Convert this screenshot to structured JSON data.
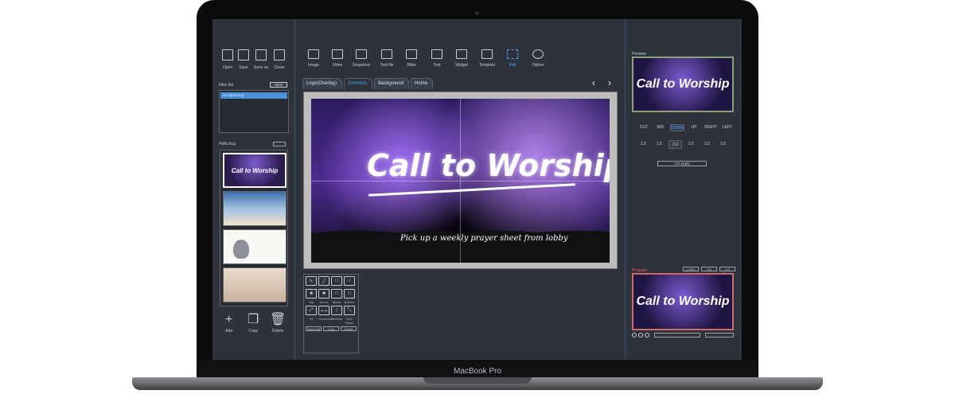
{
  "device": {
    "brand": "MacBook Pro"
  },
  "left_toolbar": [
    {
      "label": "Open",
      "icon": "file-icon"
    },
    {
      "label": "Save",
      "icon": "save-icon"
    },
    {
      "label": "Save as",
      "icon": "save-as-icon"
    },
    {
      "label": "Close",
      "icon": "close-file-icon"
    }
  ],
  "files": {
    "label": "Files list",
    "new_label": "NEW",
    "items": [
      "no name.hcg"
    ]
  },
  "hcg": {
    "label": "Hello.hcg"
  },
  "thumbs": [
    {
      "caption": "Call to Worship"
    },
    {
      "caption": ""
    },
    {
      "caption": ""
    },
    {
      "caption": ""
    }
  ],
  "left_actions": [
    {
      "label": "Add",
      "icon": "+"
    },
    {
      "label": "Copy",
      "icon": "❐"
    },
    {
      "label": "Delete",
      "icon": "🗑"
    }
  ],
  "top_toolbar": [
    {
      "label": "Image",
      "icon": "image-icon"
    },
    {
      "label": "Video",
      "icon": "video-icon"
    },
    {
      "label": "Sequence",
      "icon": "sequence-icon"
    },
    {
      "label": "Text file",
      "icon": "text-file-icon"
    },
    {
      "label": "Bible",
      "icon": "bible-icon"
    },
    {
      "label": "Text",
      "icon": "text-icon"
    },
    {
      "label": "Widget",
      "icon": "widget-icon"
    },
    {
      "label": "Template",
      "icon": "template-icon"
    },
    {
      "label": "Edit",
      "icon": "edit-icon",
      "active": true
    },
    {
      "label": "Option",
      "icon": "gear-icon"
    }
  ],
  "tabs": [
    {
      "label": "Logo(Overlay)"
    },
    {
      "label": "Contents",
      "active": true
    },
    {
      "label": "Background"
    },
    {
      "label": "Home"
    }
  ],
  "slide": {
    "title": "Call to Worship",
    "subtitle": "Pick up a weekly prayer sheet from lobby"
  },
  "shape_panel": {
    "row1": [
      "pen",
      "line",
      "rect",
      "circle"
    ],
    "row2_labels": [
      "Top",
      "Above",
      "Below",
      "Bottom"
    ],
    "row3_labels": [
      "Fit",
      "Horizontal",
      "Vertical",
      "Size Reset"
    ],
    "buttons": [
      "Select All",
      "Copy",
      "Delete"
    ]
  },
  "right": {
    "preview_label": "Preview",
    "preview_title": "Call to Worship",
    "transitions": [
      "CUT",
      "MIX",
      "DOWN",
      "UP",
      "RIGHT",
      "LEFT"
    ],
    "selected_transition": "DOWN",
    "speeds": [
      "1.0",
      "1.5",
      "2.0",
      "2.5",
      "3.0",
      "3.5"
    ],
    "selected_speed": "2.0",
    "cg_apply": "CG Apply",
    "program_label": "Program",
    "program_buttons": [
      "LOGO",
      "CG",
      "CG Cancle"
    ],
    "program_title": "Call to Worship"
  },
  "colors": {
    "accent": "#4aa3ff",
    "program": "#ff5a5a",
    "bg": "#2d323b"
  }
}
